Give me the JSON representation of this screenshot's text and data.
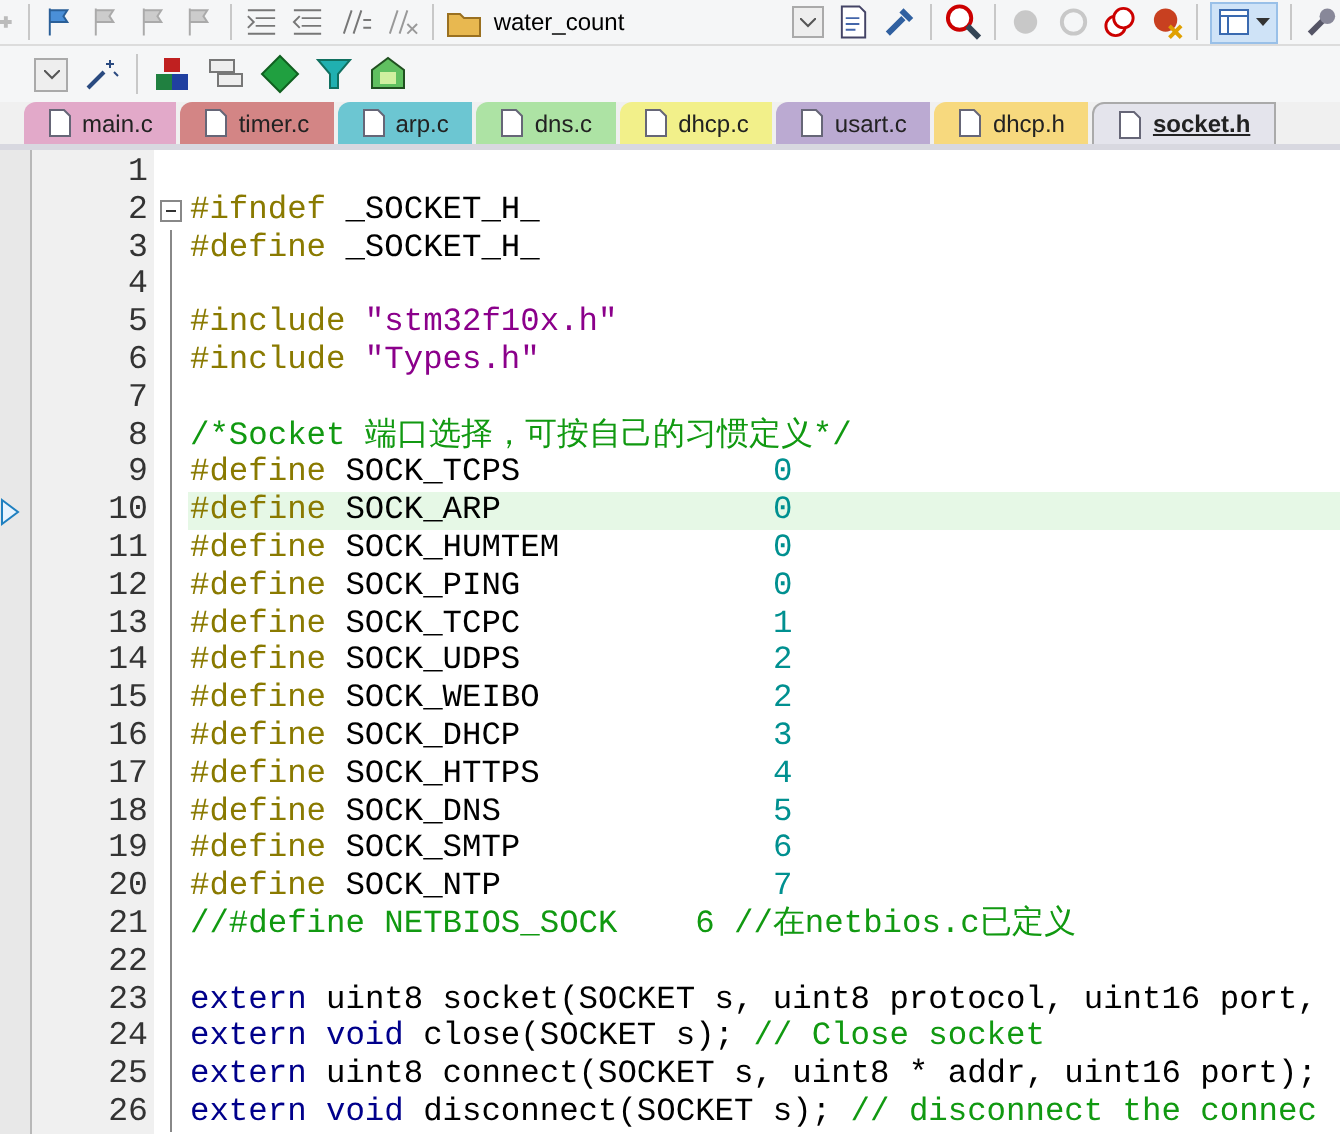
{
  "toolbar": {
    "target": "water_count"
  },
  "tabs": [
    {
      "label": "main.c",
      "color": "#e2a9c9",
      "selected": false
    },
    {
      "label": "timer.c",
      "color": "#d38585",
      "selected": false
    },
    {
      "label": "arp.c",
      "color": "#6cc6d2",
      "selected": false
    },
    {
      "label": "dns.c",
      "color": "#ade3a4",
      "selected": false
    },
    {
      "label": "dhcp.c",
      "color": "#f2f08a",
      "selected": false
    },
    {
      "label": "usart.c",
      "color": "#bbaad2",
      "selected": false
    },
    {
      "label": "dhcp.h",
      "color": "#f7d97e",
      "selected": false
    },
    {
      "label": "socket.h",
      "color": "#e4e4ec",
      "selected": true
    }
  ],
  "editor": {
    "lines": [
      {
        "number": "1",
        "current": false,
        "fold": false
      },
      {
        "number": "2",
        "current": false,
        "fold": true,
        "tokens": [
          {
            "kind": "directive",
            "text": "#ifndef"
          },
          {
            "kind": "plain",
            "text": " _SOCKET_H_"
          }
        ]
      },
      {
        "number": "3",
        "current": false,
        "fold": false,
        "tokens": [
          {
            "kind": "directive",
            "text": "#define"
          },
          {
            "kind": "plain",
            "text": " _SOCKET_H_"
          }
        ]
      },
      {
        "number": "4",
        "current": false,
        "fold": false
      },
      {
        "number": "5",
        "current": false,
        "fold": false,
        "tokens": [
          {
            "kind": "directive",
            "text": "#include"
          },
          {
            "kind": "string",
            "text": " \"stm32f10x.h\""
          }
        ]
      },
      {
        "number": "6",
        "current": false,
        "fold": false,
        "tokens": [
          {
            "kind": "directive",
            "text": "#include"
          },
          {
            "kind": "string",
            "text": " \"Types.h\""
          }
        ]
      },
      {
        "number": "7",
        "current": false,
        "fold": false
      },
      {
        "number": "8",
        "current": false,
        "fold": false,
        "tokens": [
          {
            "kind": "comment",
            "text": "/*Socket 端口选择，可按自己的习惯定义*/"
          }
        ]
      },
      {
        "number": "9",
        "current": false,
        "fold": false,
        "tokens": [
          {
            "kind": "directive",
            "text": "#define"
          },
          {
            "kind": "plain",
            "text": " SOCK_TCPS             "
          },
          {
            "kind": "number",
            "text": "0"
          }
        ]
      },
      {
        "number": "10",
        "current": true,
        "fold": false,
        "tokens": [
          {
            "kind": "directive",
            "text": "#define"
          },
          {
            "kind": "plain",
            "text": " SOCK_ARP              "
          },
          {
            "kind": "number",
            "text": "0"
          }
        ]
      },
      {
        "number": "11",
        "current": false,
        "fold": false,
        "tokens": [
          {
            "kind": "directive",
            "text": "#define"
          },
          {
            "kind": "plain",
            "text": " SOCK_HUMTEM           "
          },
          {
            "kind": "number",
            "text": "0"
          }
        ]
      },
      {
        "number": "12",
        "current": false,
        "fold": false,
        "tokens": [
          {
            "kind": "directive",
            "text": "#define"
          },
          {
            "kind": "plain",
            "text": " SOCK_PING             "
          },
          {
            "kind": "number",
            "text": "0"
          }
        ]
      },
      {
        "number": "13",
        "current": false,
        "fold": false,
        "tokens": [
          {
            "kind": "directive",
            "text": "#define"
          },
          {
            "kind": "plain",
            "text": " SOCK_TCPC             "
          },
          {
            "kind": "number",
            "text": "1"
          }
        ]
      },
      {
        "number": "14",
        "current": false,
        "fold": false,
        "tokens": [
          {
            "kind": "directive",
            "text": "#define"
          },
          {
            "kind": "plain",
            "text": " SOCK_UDPS             "
          },
          {
            "kind": "number",
            "text": "2"
          }
        ]
      },
      {
        "number": "15",
        "current": false,
        "fold": false,
        "tokens": [
          {
            "kind": "directive",
            "text": "#define"
          },
          {
            "kind": "plain",
            "text": " SOCK_WEIBO            "
          },
          {
            "kind": "number",
            "text": "2"
          }
        ]
      },
      {
        "number": "16",
        "current": false,
        "fold": false,
        "tokens": [
          {
            "kind": "directive",
            "text": "#define"
          },
          {
            "kind": "plain",
            "text": " SOCK_DHCP             "
          },
          {
            "kind": "number",
            "text": "3"
          }
        ]
      },
      {
        "number": "17",
        "current": false,
        "fold": false,
        "tokens": [
          {
            "kind": "directive",
            "text": "#define"
          },
          {
            "kind": "plain",
            "text": " SOCK_HTTPS            "
          },
          {
            "kind": "number",
            "text": "4"
          }
        ]
      },
      {
        "number": "18",
        "current": false,
        "fold": false,
        "tokens": [
          {
            "kind": "directive",
            "text": "#define"
          },
          {
            "kind": "plain",
            "text": " SOCK_DNS              "
          },
          {
            "kind": "number",
            "text": "5"
          }
        ]
      },
      {
        "number": "19",
        "current": false,
        "fold": false,
        "tokens": [
          {
            "kind": "directive",
            "text": "#define"
          },
          {
            "kind": "plain",
            "text": " SOCK_SMTP             "
          },
          {
            "kind": "number",
            "text": "6"
          }
        ]
      },
      {
        "number": "20",
        "current": false,
        "fold": false,
        "tokens": [
          {
            "kind": "directive",
            "text": "#define"
          },
          {
            "kind": "plain",
            "text": " SOCK_NTP              "
          },
          {
            "kind": "number",
            "text": "7"
          }
        ]
      },
      {
        "number": "21",
        "current": false,
        "fold": false,
        "tokens": [
          {
            "kind": "comment",
            "text": "//#define NETBIOS_SOCK    6 //在netbios.c已定义"
          }
        ]
      },
      {
        "number": "22",
        "current": false,
        "fold": false
      },
      {
        "number": "23",
        "current": false,
        "fold": false,
        "tokens": [
          {
            "kind": "keyword",
            "text": "extern"
          },
          {
            "kind": "plain",
            "text": " uint8 socket(SOCKET s, uint8 protocol, uint16 port,"
          }
        ]
      },
      {
        "number": "24",
        "current": false,
        "fold": false,
        "tokens": [
          {
            "kind": "keyword",
            "text": "extern void"
          },
          {
            "kind": "plain",
            "text": " close(SOCKET s); "
          },
          {
            "kind": "comment",
            "text": "// Close socket"
          }
        ]
      },
      {
        "number": "25",
        "current": false,
        "fold": false,
        "tokens": [
          {
            "kind": "keyword",
            "text": "extern"
          },
          {
            "kind": "plain",
            "text": " uint8 connect(SOCKET s, uint8 * addr, uint16 port);"
          }
        ]
      },
      {
        "number": "26",
        "current": false,
        "fold": false,
        "tokens": [
          {
            "kind": "keyword",
            "text": "extern void"
          },
          {
            "kind": "plain",
            "text": " disconnect(SOCKET s); "
          },
          {
            "kind": "comment",
            "text": "// disconnect the connec"
          }
        ]
      }
    ]
  }
}
